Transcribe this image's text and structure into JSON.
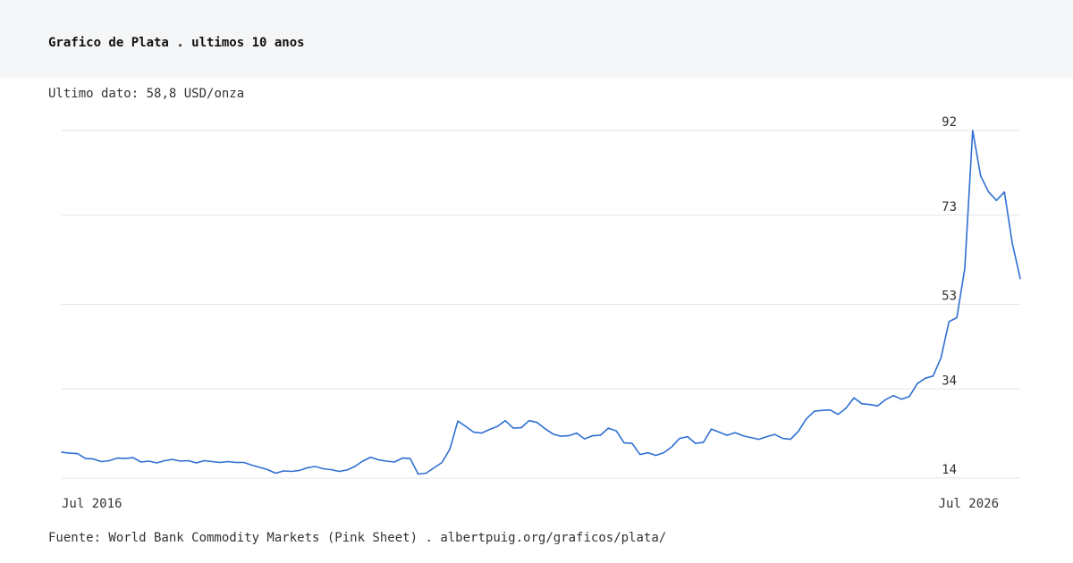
{
  "header": {
    "title": "Grafico de Plata . ultimos 10 anos"
  },
  "latest": {
    "label": "Ultimo dato:",
    "value": "58,8 USD/onza"
  },
  "chart_data": {
    "type": "line",
    "title": "",
    "xlabel": "",
    "ylabel": "",
    "x_ticks": [
      "Jul 2016",
      "Jul 2026"
    ],
    "y_ticks": [
      14,
      34,
      53,
      73,
      92
    ],
    "ylim": [
      14,
      92
    ],
    "grid": true,
    "legend": "none",
    "line_color": "#2f6fd1",
    "series": [
      {
        "values": [
          19.8,
          19.6,
          19.5,
          18.4,
          18.3,
          17.7,
          17.9,
          18.5,
          18.4,
          18.6,
          17.6,
          17.8,
          17.4,
          17.9,
          18.2,
          17.8,
          17.9,
          17.4,
          17.9,
          17.7,
          17.5,
          17.7,
          17.5,
          17.5,
          16.9,
          16.4,
          15.9,
          15.1,
          15.6,
          15.5,
          15.7,
          16.3,
          16.6,
          16.1,
          15.9,
          15.5,
          15.8,
          16.6,
          17.8,
          18.7,
          18.1,
          17.8,
          17.6,
          18.5,
          18.4,
          14.9,
          15.1,
          16.3,
          17.5,
          20.5,
          26.8,
          25.6,
          24.3,
          24.1,
          24.9,
          25.6,
          26.9,
          25.2,
          25.3,
          26.9,
          26.5,
          25.1,
          23.9,
          23.4,
          23.5,
          24.1,
          22.8,
          23.5,
          23.6,
          25.2,
          24.6,
          21.9,
          21.8,
          19.3,
          19.7,
          19.1,
          19.7,
          21.0,
          22.9,
          23.3,
          21.8,
          22.0,
          25.0,
          24.3,
          23.6,
          24.2,
          23.5,
          23.1,
          22.7,
          23.3,
          23.8,
          22.9,
          22.7,
          24.5,
          27.3,
          29.0,
          29.2,
          29.3,
          28.3,
          29.7,
          32.0,
          30.7,
          30.5,
          30.2,
          31.6,
          32.5,
          31.7,
          32.3,
          35.2,
          36.4,
          36.9,
          41.0,
          49.1,
          50.0,
          61.1,
          92.0,
          81.8,
          78.2,
          76.3,
          78.2,
          66.7,
          58.8
        ]
      }
    ]
  },
  "footer": {
    "source_label": "Fuente: World Bank Commodity Markets (Pink Sheet)",
    "separator": ".",
    "url": "albertpuig.org/graficos/plata/"
  }
}
